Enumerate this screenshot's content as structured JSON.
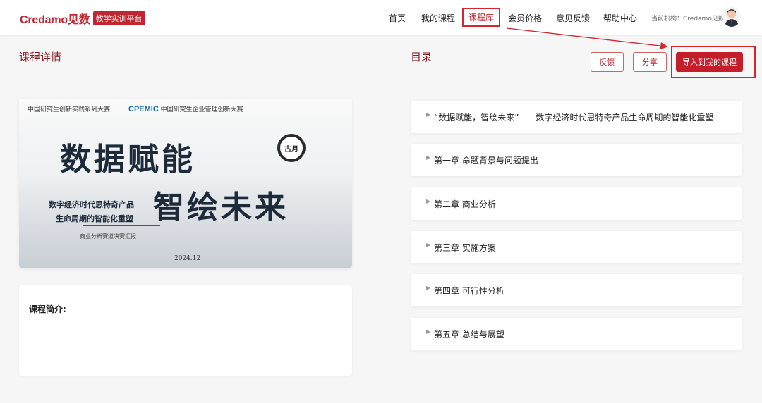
{
  "header": {
    "logo_text": "Credamo见数",
    "logo_badge": "教学实训平台",
    "nav": [
      "首页",
      "我的课程",
      "课程库",
      "会员价格",
      "意见反馈",
      "帮助中心"
    ],
    "active_nav": "课程库",
    "org_label": "当前机构：Credamo见数"
  },
  "left": {
    "title": "课程详情",
    "banner": {
      "org1": "中国研究生创新实践系列大赛",
      "org2_prefix": "CPEMIC",
      "org2": "中国研究生企业管理创新大赛",
      "title1": "数据赋能",
      "title2": "智绘未来",
      "sub1": "数字经济时代思特奇产品",
      "sub2": "生命周期的智能化重塑",
      "sub3": "商业分析赛道决赛汇报",
      "seal": "古月",
      "date": "2024.12"
    },
    "intro_label": "课程简介:"
  },
  "right": {
    "title": "目录",
    "buttons": {
      "feedback": "反馈",
      "share": "分享",
      "import": "导入到我的课程"
    },
    "chapters": [
      "“数据赋能，智绘未来”——数字经济时代思特奇产品生命周期的智能化重塑",
      "第一章 命题背景与问题提出",
      "第二章 商业分析",
      "第三章 实施方案",
      "第四章 可行性分析",
      "第五章 总结与展望"
    ]
  },
  "colors": {
    "brand": "#c12630",
    "highlight": "#d3262e"
  }
}
